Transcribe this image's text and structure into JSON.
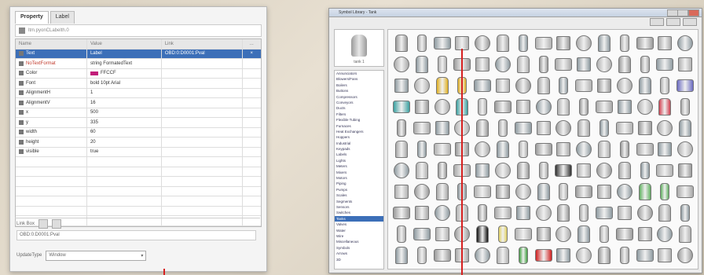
{
  "left_panel": {
    "tabs": [
      "Property",
      "Label"
    ],
    "path": "ltm.pyonCLabelth.0",
    "columns": [
      "Name",
      "Value",
      "Link",
      "..."
    ],
    "rows": [
      {
        "name": "Text",
        "value": "Label",
        "link": "OBD:0:D0001:Pval",
        "extra": "×",
        "selected": true
      },
      {
        "name": "NoTextFormat",
        "value": "string FormatedText",
        "link": "",
        "extra": "",
        "red": true
      },
      {
        "name": "Color",
        "value": "FFCCF",
        "link": "",
        "extra": "",
        "swatch": "#c21d7a"
      },
      {
        "name": "Font",
        "value": "bold 10pt Arial",
        "link": "",
        "extra": ""
      },
      {
        "name": "AlignmentH",
        "value": "1",
        "link": "",
        "extra": ""
      },
      {
        "name": "AlignmentV",
        "value": "16",
        "link": "",
        "extra": ""
      },
      {
        "name": "x",
        "value": "500",
        "link": "",
        "extra": ""
      },
      {
        "name": "y",
        "value": "335",
        "link": "",
        "extra": ""
      },
      {
        "name": "width",
        "value": "60",
        "link": "",
        "extra": ""
      },
      {
        "name": "height",
        "value": "20",
        "link": "",
        "extra": ""
      },
      {
        "name": "visible",
        "value": "true",
        "link": "",
        "extra": ""
      }
    ],
    "link_box_label": "Link Box",
    "link_value": "OBD:0:D0001:Pval",
    "update_label": "UpdateType",
    "update_value": "Window"
  },
  "right_panel": {
    "title": "Symbol Library - Tank",
    "preview_label": "tank 1",
    "categories": [
      "Annunciators",
      "Blowers/Fans",
      "Boilers",
      "Buttons",
      "Compressors",
      "Conveyors",
      "Ducts",
      "Filters",
      "Flexible Tubing",
      "Furnaces",
      "Heat Exchangers",
      "Hoppers",
      "Industrial",
      "Keypads",
      "Labels",
      "Lights",
      "Meters",
      "Mixers",
      "Motors",
      "Piping",
      "Pumps",
      "Scales",
      "Segments",
      "Sensors",
      "Switches",
      "Tanks",
      "Valves",
      "Water",
      "Wire",
      "Miscellaneous",
      "Symbols",
      "Arrows",
      "3D"
    ],
    "selected_category": "Tanks"
  }
}
